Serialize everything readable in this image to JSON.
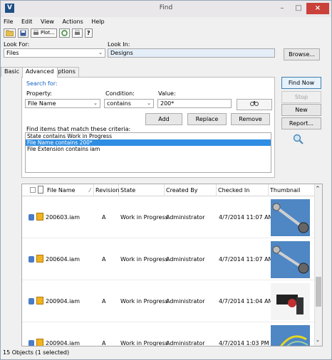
{
  "window": {
    "title": "Find",
    "min_icon": "–",
    "max_icon": "□",
    "close_icon": "×"
  },
  "menu": [
    "File",
    "Edit",
    "View",
    "Actions",
    "Help"
  ],
  "toolbar": {
    "plot_label": "Plot..."
  },
  "look_for": {
    "label": "Look For:",
    "value": "Files"
  },
  "look_in": {
    "label": "Look In:",
    "value": "Designs"
  },
  "browse_label": "Browse...",
  "tabs": [
    "Basic",
    "Advanced",
    "Options"
  ],
  "search_for": "Search for:",
  "property": {
    "label": "Property:",
    "value": "File Name"
  },
  "condition": {
    "label": "Condition:",
    "value": "contains"
  },
  "value_field": {
    "label": "Value:",
    "value": "200*"
  },
  "buttons": {
    "add": "Add",
    "replace": "Replace",
    "remove": "Remove",
    "find_now": "Find Now",
    "stop": "Stop",
    "new": "New",
    "report": "Report..."
  },
  "criteria_label": "Find items that match these criteria:",
  "criteria": [
    "State contains Work in Progress",
    "File Name contains 200*",
    "File Extension contains iam"
  ],
  "columns": [
    "File Name",
    "Revision",
    "State",
    "Created By",
    "Checked In",
    "Thumbnail"
  ],
  "rows": [
    {
      "file": "200603.iam",
      "rev": "A",
      "state": "Work in Progress",
      "by": "Administrator",
      "checked": "4/7/2014 11:07 AM"
    },
    {
      "file": "200604.iam",
      "rev": "A",
      "state": "Work in Progress",
      "by": "Administrator",
      "checked": "4/7/2014 11:07 AM"
    },
    {
      "file": "200904.iam",
      "rev": "A",
      "state": "Work in Progress",
      "by": "Administrator",
      "checked": "4/7/2014 11:04 AM"
    },
    {
      "file": "200904.iam",
      "rev": "A",
      "state": "Work in Progress",
      "by": "Administrator",
      "checked": "4/7/2014 1:03 PM"
    }
  ],
  "status": "15 Objects (1 selected)"
}
